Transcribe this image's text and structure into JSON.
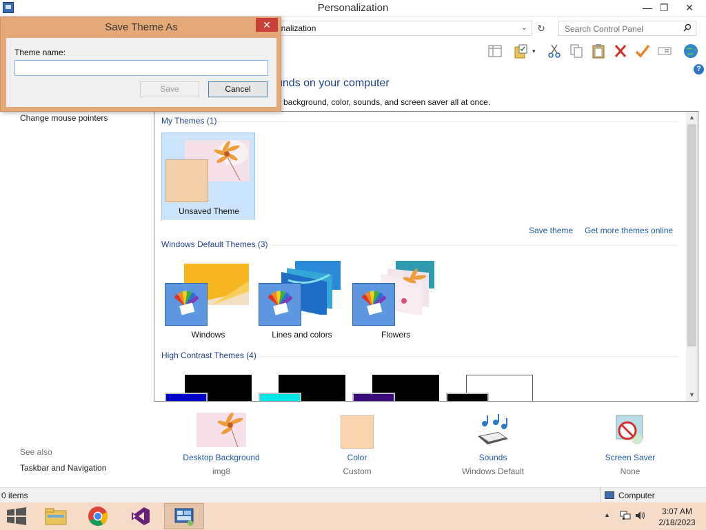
{
  "window": {
    "title": "Personalization"
  },
  "address": {
    "path": "onalization",
    "search_placeholder": "Search Control Panel"
  },
  "main": {
    "heading": "unds on your computer",
    "subheading": "p background, color, sounds, and screen saver all at once."
  },
  "left_nav": {
    "links": [
      "Change mouse pointers"
    ],
    "see_also_label": "See also",
    "see_also_links": [
      "Taskbar and Navigation"
    ]
  },
  "themes": {
    "my_themes_header": "My Themes (1)",
    "my_themes": [
      {
        "name": "Unsaved Theme",
        "accent": "#f3cfa7"
      }
    ],
    "save_theme_link": "Save theme",
    "get_more_link": "Get more themes online",
    "default_header": "Windows Default Themes (3)",
    "default_themes": [
      {
        "name": "Windows",
        "accent": "#4c8fe0"
      },
      {
        "name": "Lines and colors",
        "accent": "#4c8fe0"
      },
      {
        "name": "Flowers",
        "accent": "#4c8fe0"
      }
    ],
    "high_contrast_header": "High Contrast Themes (4)",
    "high_contrast": [
      {
        "swatch": "#0000cc",
        "bg": "#000000"
      },
      {
        "swatch": "#00e5e5",
        "bg": "#000000"
      },
      {
        "swatch": "#3a0a7a",
        "bg": "#000000"
      },
      {
        "swatch": "#000000",
        "bg": "#ffffff"
      }
    ]
  },
  "customize": [
    {
      "title": "Desktop Background",
      "value": "img8",
      "icon": "desktop-background-icon"
    },
    {
      "title": "Color",
      "value": "Custom",
      "icon": "color-swatch-icon"
    },
    {
      "title": "Sounds",
      "value": "Windows Default",
      "icon": "sounds-icon"
    },
    {
      "title": "Screen Saver",
      "value": "None",
      "icon": "screen-saver-icon"
    }
  ],
  "status": {
    "items": "0 items",
    "computer": "Computer"
  },
  "taskbar": {
    "apps": [
      "file-explorer-icon",
      "chrome-icon",
      "visual-studio-icon",
      "control-panel-icon"
    ],
    "time": "3:07 AM",
    "date": "2/18/2023"
  },
  "dialog": {
    "title": "Save Theme As",
    "label": "Theme name:",
    "input_value": "",
    "save_label": "Save",
    "cancel_label": "Cancel"
  },
  "colors": {
    "link": "#1e5aa8",
    "heading": "#1e3f8a",
    "dialog_frame": "#e5a877",
    "taskbar": "#f5dcc9"
  }
}
